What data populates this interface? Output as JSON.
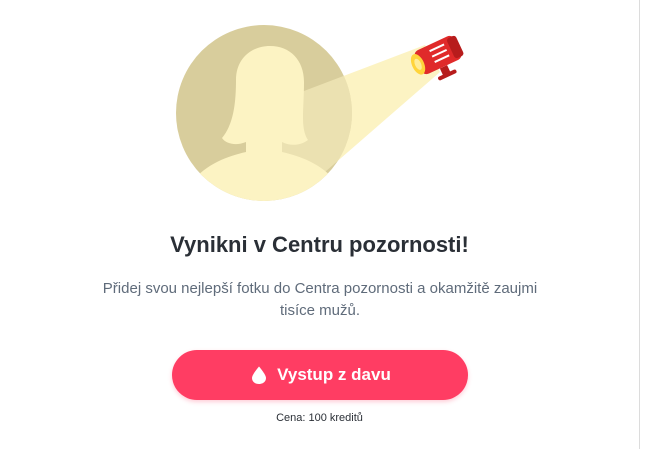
{
  "spotlight": {
    "title": "Vynikni v Centru pozornosti!",
    "description": "Přidej svou nejlepší fotku do Centra pozornosti a okamžitě zaujmi tisíce mužů.",
    "cta_label": "Vystup z davu",
    "price_text": "Cena: 100 kreditů"
  },
  "colors": {
    "avatar_circle": "#d8cd9c",
    "silhouette": "#fcf3c3",
    "light_beam": "#fcf3c3",
    "projector_red": "#e02a2a",
    "projector_lens": "#ffd43b",
    "cta_background": "#ff3d63"
  },
  "icons": {
    "hero": "spotlight-avatar-illustration",
    "cta": "drop-icon"
  }
}
